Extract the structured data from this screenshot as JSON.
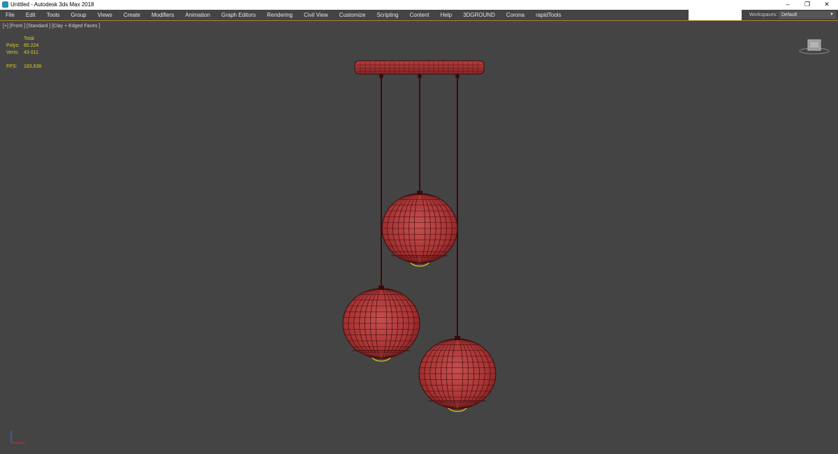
{
  "window": {
    "title": "Untitled - Autodesk 3ds Max 2018",
    "controls": {
      "minimize": "–",
      "restore": "❐",
      "close": "✕"
    }
  },
  "menu": {
    "items": [
      "File",
      "Edit",
      "Tools",
      "Group",
      "Views",
      "Create",
      "Modifiers",
      "Animation",
      "Graph Editors",
      "Rendering",
      "Civil View",
      "Customize",
      "Scripting",
      "Content",
      "Help",
      "3DGROUND",
      "Corona",
      "rapidTools"
    ]
  },
  "workspaces": {
    "label": "Workspaces:",
    "value": "Default"
  },
  "viewport": {
    "label": "[+] [Front ] [Standard ] [Clay + Edged Faces ]",
    "stats": {
      "total_label": "Total",
      "polys_label": "Polys:",
      "polys_value": "85 224",
      "verts_label": "Verts:",
      "verts_value": "43 011",
      "fps_label": "FPS:",
      "fps_value": "183,638"
    }
  },
  "colors": {
    "mesh": "#b23a3a",
    "wire": "#3a0a0a",
    "menu_accent": "#a8853a",
    "stats_text": "#d8cf20",
    "bulb": "#e2c21a"
  },
  "icons": [
    "app-icon",
    "minimize-icon",
    "restore-icon",
    "close-icon",
    "dropdown-arrow-icon",
    "viewcube-icon",
    "axis-tripod-icon"
  ]
}
